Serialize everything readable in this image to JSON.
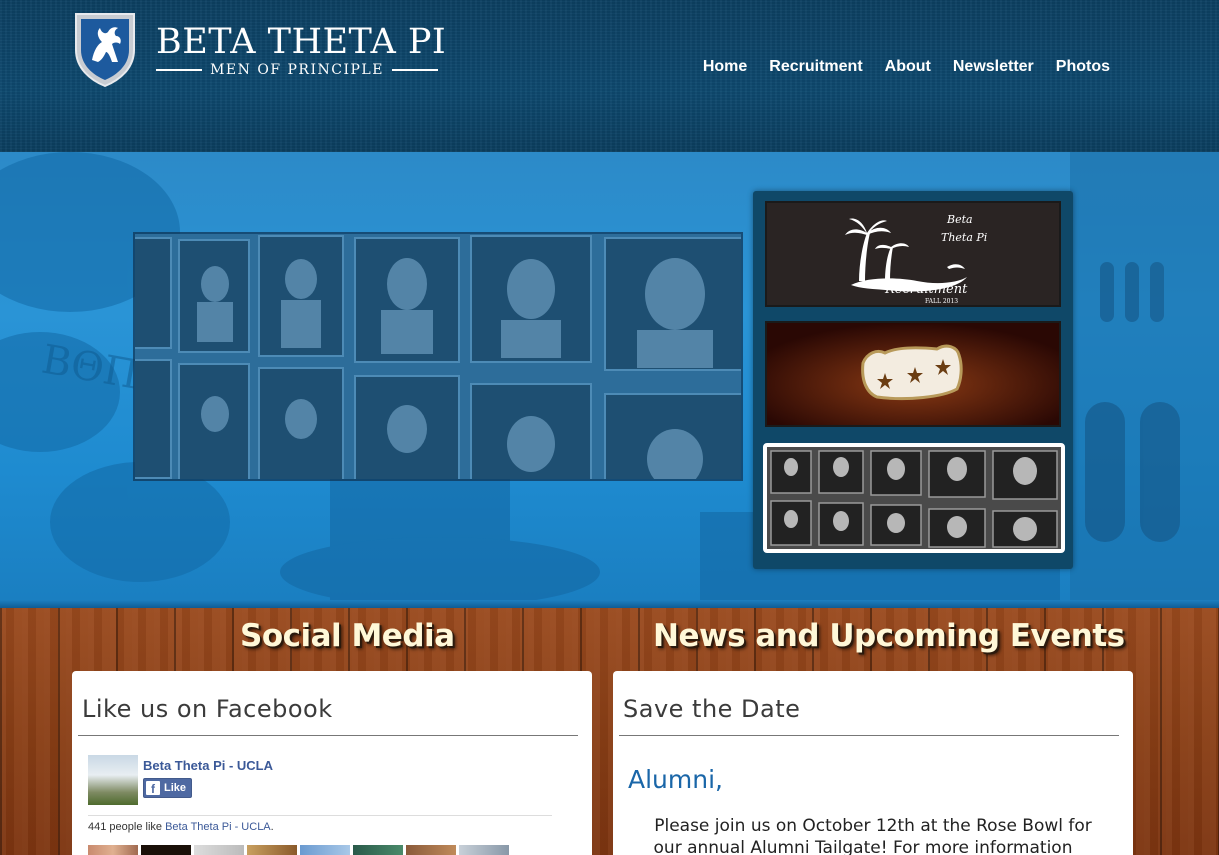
{
  "brand": {
    "title": "BETA THETA PI",
    "tagline": "MEN OF PRINCIPLE",
    "logo_icon": "griffin-shield-icon"
  },
  "nav": {
    "items": [
      {
        "label": "Home"
      },
      {
        "label": "Recruitment"
      },
      {
        "label": "About"
      },
      {
        "label": "Newsletter"
      },
      {
        "label": "Photos"
      }
    ]
  },
  "hero": {
    "background_overlay_text": "ΒΘΠ",
    "thumbnails": [
      {
        "caption_line1": "Beta",
        "caption_line2": "Theta Pi",
        "caption_line3": "Recruitment",
        "caption_line4": "FALL 2013",
        "active": false
      },
      {
        "caption": "",
        "active": false
      },
      {
        "caption": "",
        "active": true
      }
    ]
  },
  "social": {
    "section_title": "Social Media",
    "card_title": "Like us on Facebook",
    "fb_page_name": "Beta Theta Pi - UCLA",
    "fb_like_label": "Like",
    "fb_count_prefix": "441 people like",
    "fb_count_link": "Beta Theta Pi - UCLA",
    "fb_count_suffix": "."
  },
  "news": {
    "section_title": "News and Upcoming Events",
    "card_title": "Save the Date",
    "heading": "Alumni,",
    "body": "Please join us on October 12th at the Rose Bowl for our annual Alumni Tailgate! For more information please email"
  },
  "colors": {
    "header_bg": "#0e4a70",
    "hero_blue": "#2a94d6",
    "wood": "#8a3f16",
    "section_title": "#fff8d8",
    "link_blue": "#1a66a8",
    "facebook_blue": "#3b5998"
  }
}
